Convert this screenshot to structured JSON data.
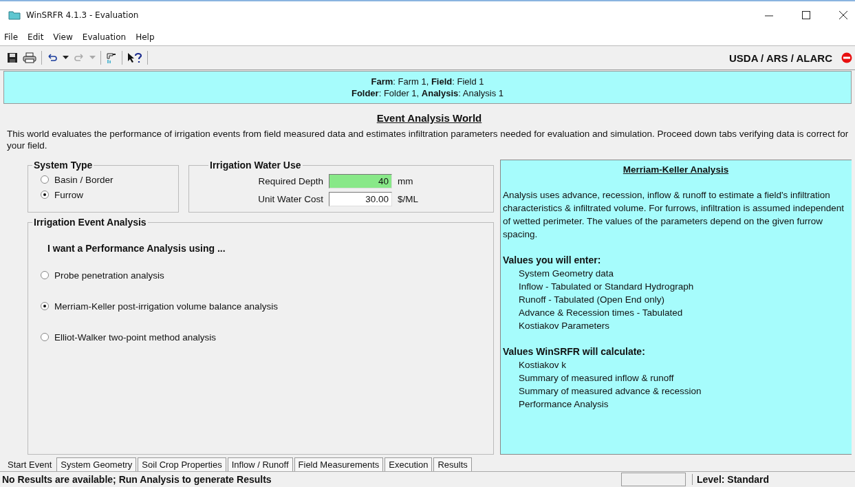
{
  "window": {
    "title": "WinSRFR 4.1.3 - Evaluation"
  },
  "menu": [
    "File",
    "Edit",
    "View",
    "Evaluation",
    "Help"
  ],
  "toolbar": {
    "org": "USDA / ARS / ALARC"
  },
  "header": {
    "lines": [
      "**Farm**: Farm 1, **Field**: Field 1",
      "**Folder**: Folder 1, **Analysis**: Analysis 1"
    ]
  },
  "world": {
    "title": "Event Analysis World",
    "description": "This world evaluates the performance of irrigation events from field measured data and estimates infiltration parameters needed for evaluation and simulation.  Proceed down tabs verifying data is correct for your field."
  },
  "system_type": {
    "title": "System Type",
    "options": [
      {
        "label": "Basin / Border",
        "selected": false
      },
      {
        "label": "Furrow",
        "selected": true
      }
    ]
  },
  "water_use": {
    "title": "Irrigation Water Use",
    "fields": [
      {
        "label": "Required Depth",
        "value": "40",
        "unit": "mm",
        "highlighted": true
      },
      {
        "label": "Unit Water Cost",
        "value": "30.00",
        "unit": "$/ML",
        "highlighted": false
      }
    ]
  },
  "event_analysis": {
    "title": "Irrigation Event Analysis",
    "prompt": "I want a Performance Analysis using ...",
    "options": [
      {
        "label": "Probe penetration analysis",
        "selected": false
      },
      {
        "label": "Merriam-Keller post-irrigation volume balance analysis",
        "selected": true
      },
      {
        "label": "Elliot-Walker two-point method analysis",
        "selected": false
      }
    ]
  },
  "info_panel": {
    "title": "Merriam-Keller Analysis",
    "paragraph": "Analysis uses advance, recession, inflow & runoff to estimate a field's infiltration characteristics & infiltrated volume.  For furrows, infiltration is assumed independent of wetted perimeter.  The values of the parameters depend on the given furrow spacing.",
    "sections": [
      {
        "heading": "Values you will enter:",
        "items": [
          "System Geometry data",
          "Inflow - Tabulated or Standard Hydrograph",
          "Runoff - Tabulated (Open End only)",
          "Advance & Recession times - Tabulated",
          "Kostiakov Parameters"
        ]
      },
      {
        "heading": "Values WinSRFR will calculate:",
        "items": [
          "Kostiakov k",
          "Summary of measured inflow & runoff",
          "Summary of measured advance & recession",
          "Performance Analysis"
        ]
      }
    ]
  },
  "tabs": [
    {
      "label": "Start Event",
      "selected": true
    },
    {
      "label": "System Geometry",
      "selected": false
    },
    {
      "label": "Soil Crop Properties",
      "selected": false
    },
    {
      "label": "Inflow / Runoff",
      "selected": false
    },
    {
      "label": "Field Measurements",
      "selected": false
    },
    {
      "label": "Execution",
      "selected": false
    },
    {
      "label": "Results",
      "selected": false
    }
  ],
  "status_bar": {
    "message": "No Results are available; Run Analysis to generate Results",
    "level": "Level: Standard"
  }
}
